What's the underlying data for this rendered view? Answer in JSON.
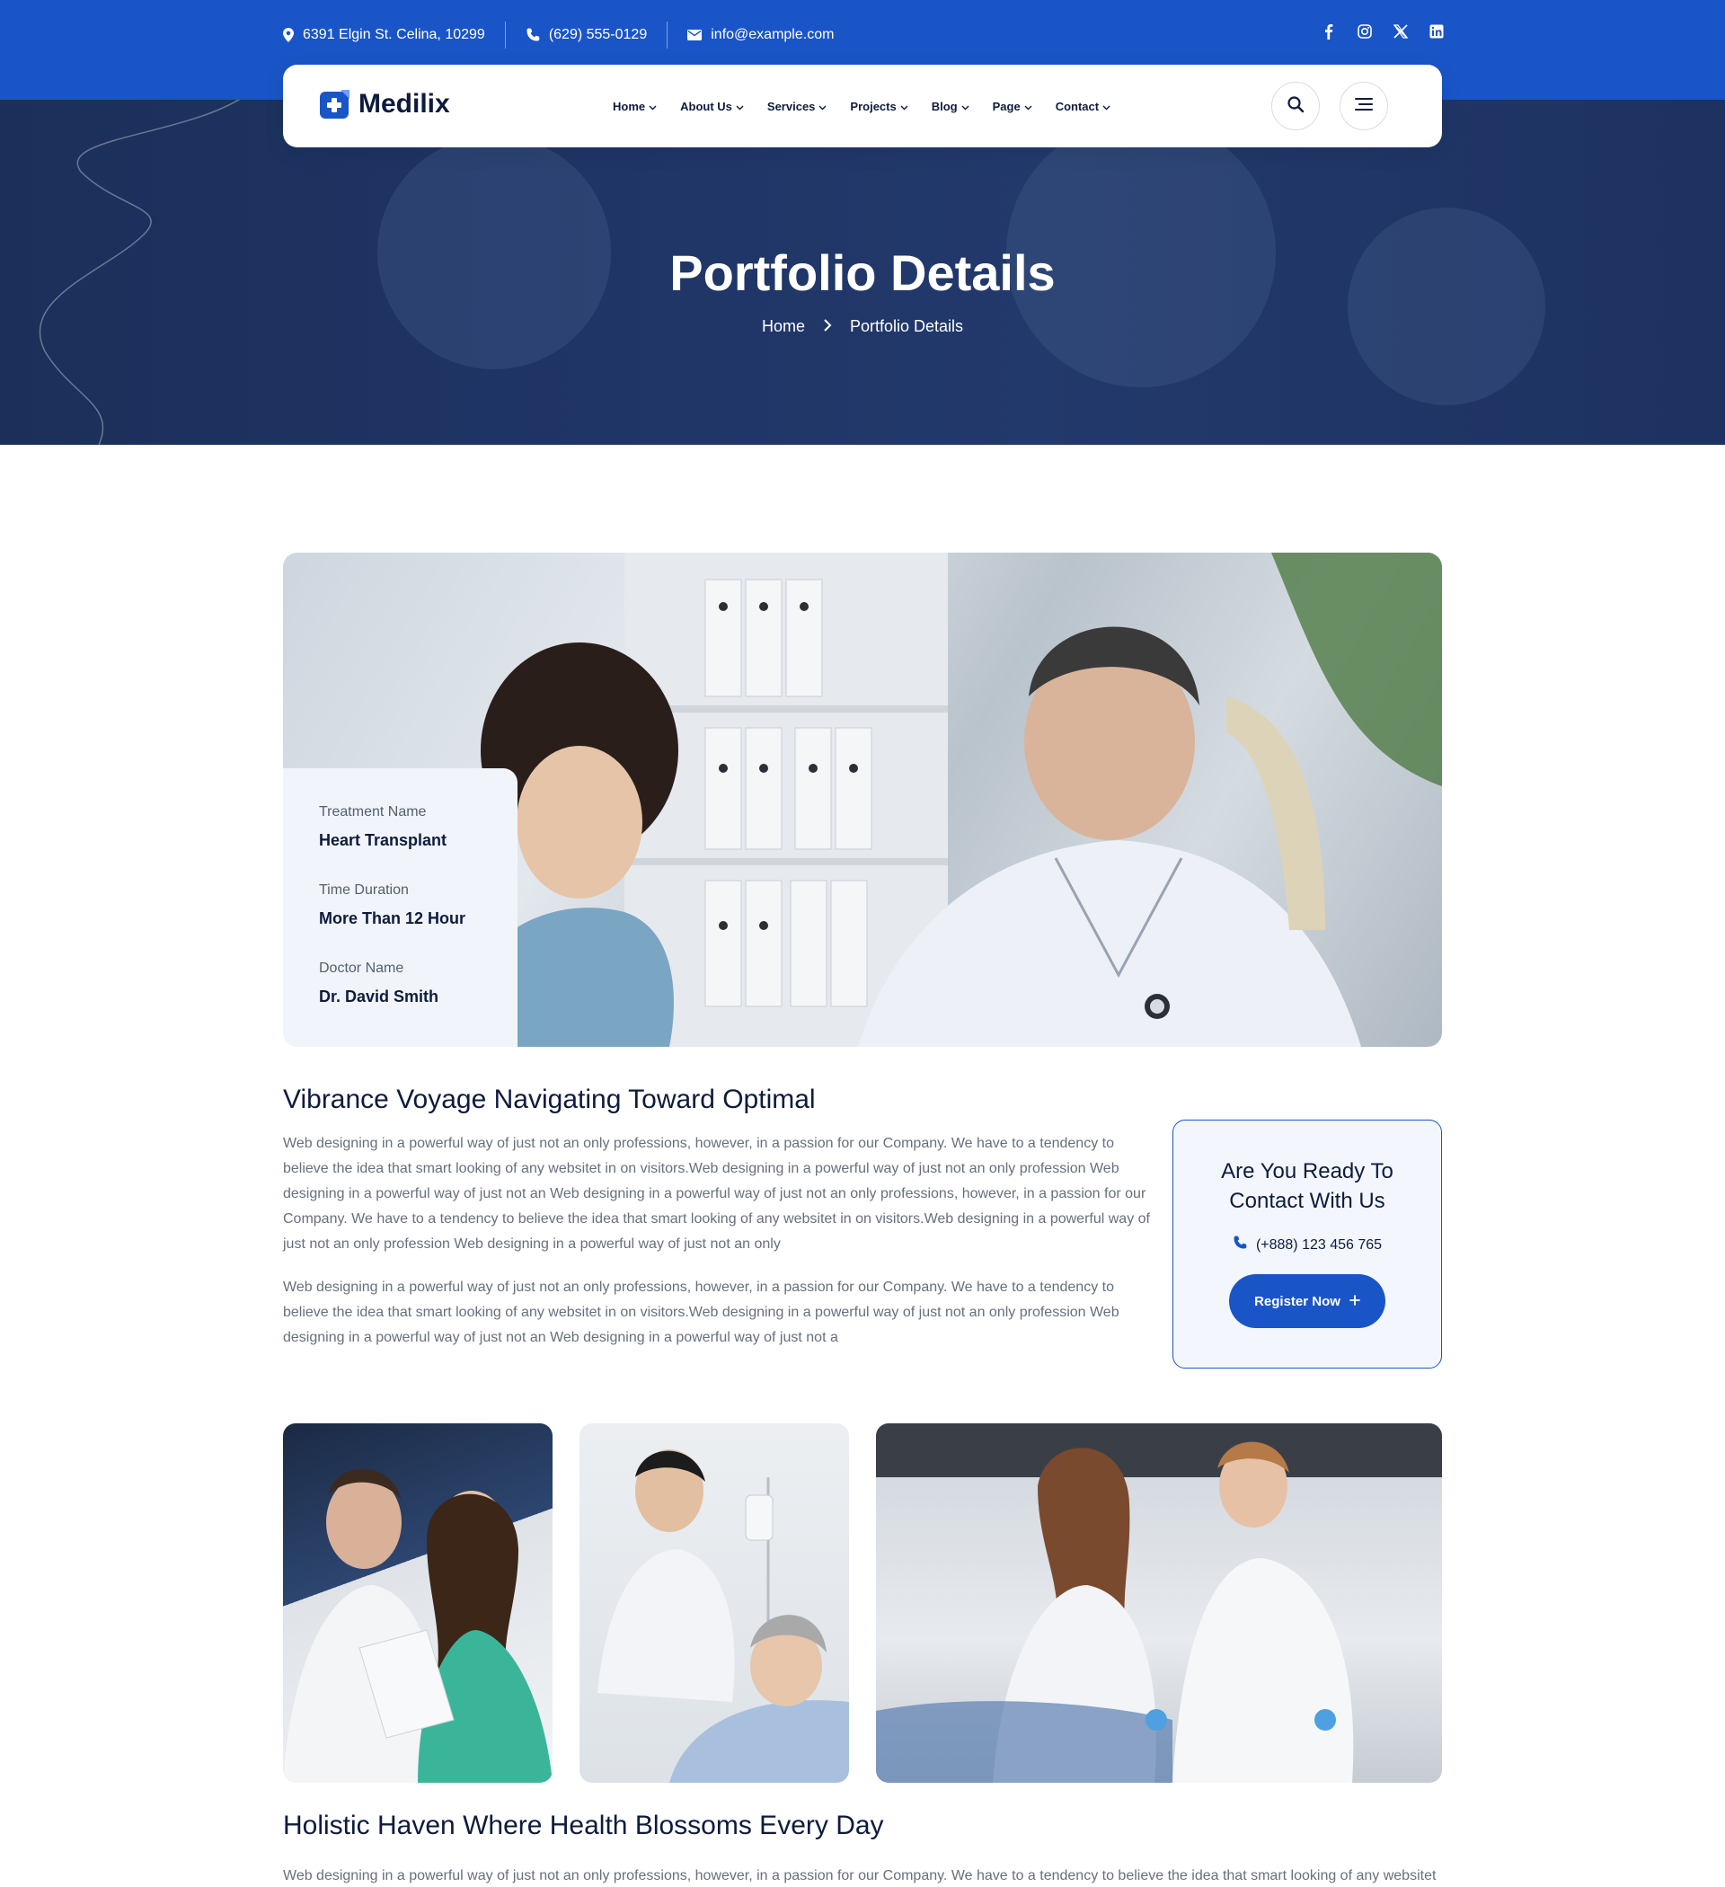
{
  "topbar": {
    "address": "6391 Elgin St. Celina, 10299",
    "phone": "(629) 555-0129",
    "email": "info@example.com",
    "social": [
      "facebook-icon",
      "instagram-icon",
      "x-icon",
      "linkedin-icon"
    ]
  },
  "brand": {
    "name": "Medilix",
    "accent": "#1a55c7",
    "dark": "#0e1b3d"
  },
  "nav": {
    "items": [
      {
        "label": "Home"
      },
      {
        "label": "About Us"
      },
      {
        "label": "Services"
      },
      {
        "label": "Projects"
      },
      {
        "label": "Blog"
      },
      {
        "label": "Page"
      },
      {
        "label": "Contact"
      }
    ]
  },
  "hero": {
    "title": "Portfolio Details",
    "breadcrumb": {
      "home": "Home",
      "current": "Portfolio Details"
    }
  },
  "info": {
    "treatment_label": "Treatment Name",
    "treatment_value": "Heart Transplant",
    "duration_label": "Time Duration",
    "duration_value": "More Than 12 Hour",
    "doctor_label": "Doctor Name",
    "doctor_value": "Dr. David Smith"
  },
  "section1": {
    "heading": "Vibrance Voyage Navigating Toward Optimal",
    "p1": "Web designing in a powerful way of just not an only professions, however, in a passion for our Company. We have to a tendency to believe the idea that smart looking of any websitet in on visitors.Web designing in a powerful way of just not an only profession Web designing in a powerful way of just not an Web designing in a powerful way of just not an only professions, however, in a passion for our Company. We have to a tendency to believe the idea that smart looking of any websitet in on visitors.Web designing in a powerful way of just not an only profession Web designing in a powerful way of just not an only",
    "p2": "Web designing in a powerful way of just not an only professions, however, in a passion for our Company. We have to a tendency to believe the idea that smart looking of any websitet in on visitors.Web designing in a powerful way of just not an only profession Web designing in a powerful way of just not an Web designing in a powerful way of just not a"
  },
  "cta": {
    "title": "Are You Ready To Contact With Us",
    "phone": "(+888) 123 456 765",
    "button": "Register Now"
  },
  "section2": {
    "heading": "Holistic Haven Where Health Blossoms Every Day",
    "p1": "Web designing in a powerful way of just not an only professions, however, in a passion for our Company. We have to a tendency to believe the idea that smart looking of any websitet"
  }
}
